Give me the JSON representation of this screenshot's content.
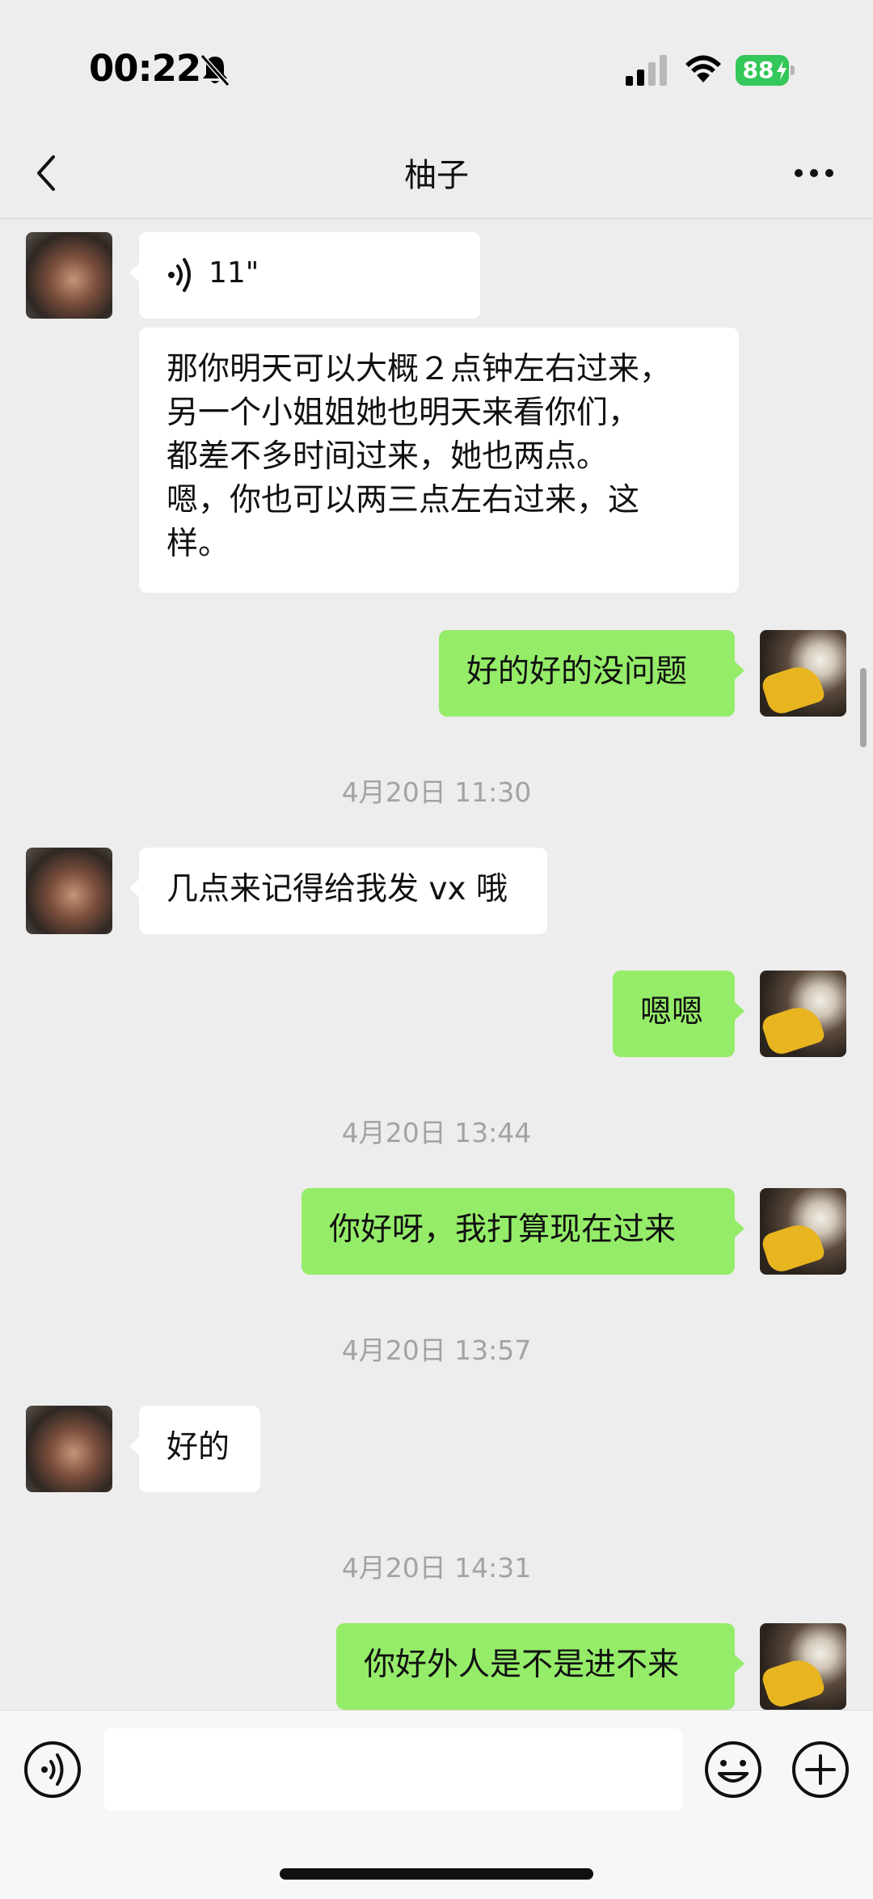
{
  "status_bar": {
    "time": "00:22",
    "battery": "88"
  },
  "nav": {
    "title": "柚子"
  },
  "messages": {
    "voice": {
      "duration": "11\""
    },
    "m1": {
      "text": "那你明天可以大概２点钟左右过来，\n另一个小姐姐她也明天来看你们，\n都差不多时间过来，她也两点。\n嗯，你也可以两三点左右过来，这\n样。"
    },
    "m2": {
      "text": "好的好的没问题"
    },
    "t1": {
      "text": "4月20日 11:30"
    },
    "m3": {
      "text": "几点来记得给我发 vx 哦"
    },
    "m4": {
      "text": "嗯嗯"
    },
    "t2": {
      "text": "4月20日 13:44"
    },
    "m5": {
      "text": "你好呀，我打算现在过来"
    },
    "t3": {
      "text": "4月20日 13:57"
    },
    "m6": {
      "text": "好的"
    },
    "t4": {
      "text": "4月20日 14:31"
    },
    "m7": {
      "text": "你好外人是不是进不来"
    }
  },
  "input": {
    "value": ""
  },
  "colors": {
    "sent_bubble": "#95ec69",
    "received_bubble": "#ffffff",
    "background": "#ededed"
  }
}
